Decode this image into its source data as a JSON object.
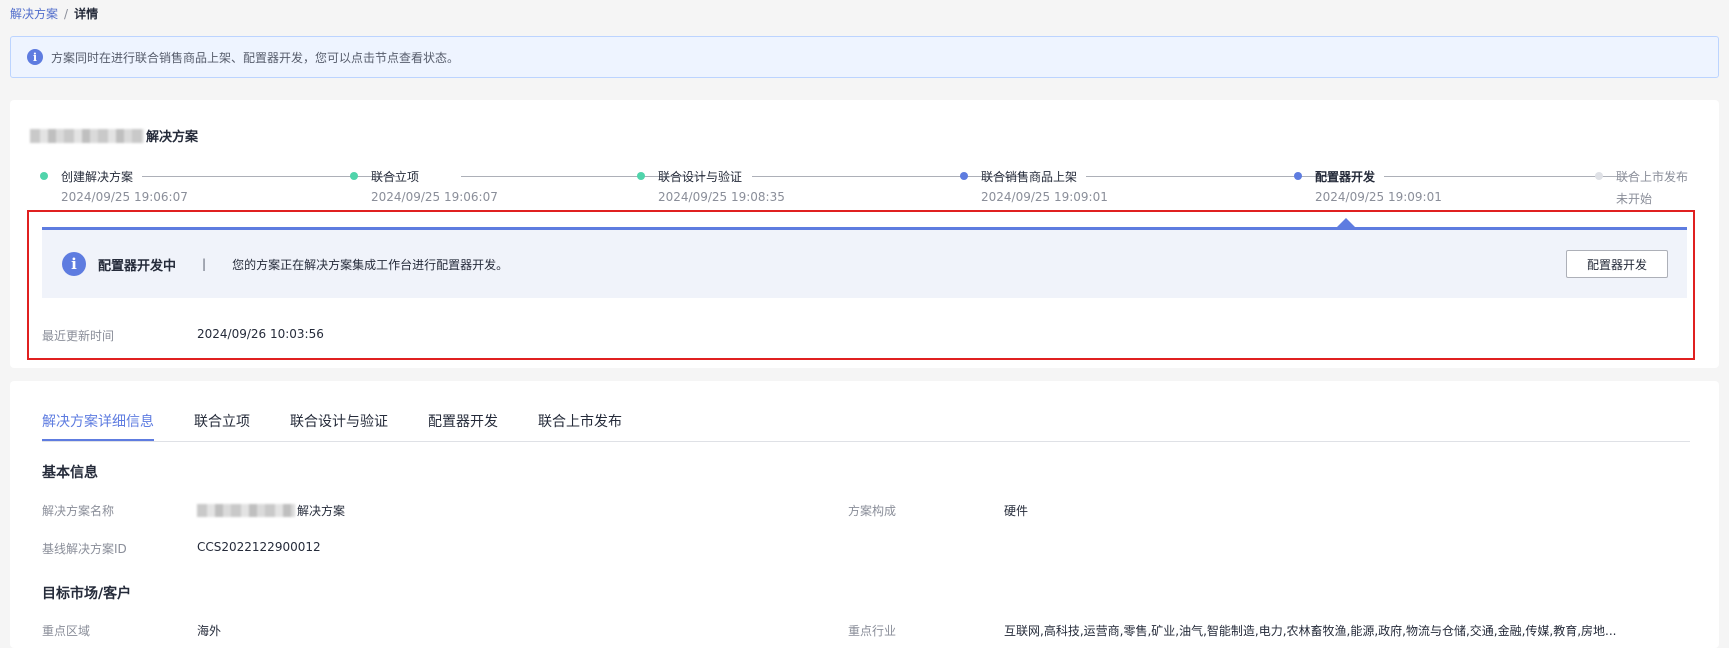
{
  "breadcrumb": {
    "parent": "解决方案",
    "separator": "/",
    "current": "详情"
  },
  "banner": {
    "icon": "info-icon",
    "text": "方案同时在进行联合销售商品上架、配置器开发，您可以点击节点查看状态。"
  },
  "solution": {
    "title_suffix": "解决方案"
  },
  "steps": [
    {
      "label": "创建解决方案",
      "time": "2024/09/25 19:06:07",
      "color": "#50d4ab"
    },
    {
      "label": "联合立项",
      "time": "2024/09/25 19:06:07",
      "color": "#50d4ab"
    },
    {
      "label": "联合设计与验证",
      "time": "2024/09/25 19:08:35",
      "color": "#50d4ab"
    },
    {
      "label": "联合销售商品上架",
      "time": "2024/09/25 19:09:01",
      "color": "#5e7ce0"
    },
    {
      "label": "配置器开发",
      "time": "2024/09/25 19:09:01",
      "color": "#5e7ce0"
    },
    {
      "label": "联合上市发布",
      "time": "未开始",
      "color": "#dfe1e6"
    }
  ],
  "status": {
    "title": "配置器开发中",
    "separator": "|",
    "description": "您的方案正在解决方案集成工作台进行配置器开发。",
    "button_label": "配置器开发"
  },
  "update": {
    "label": "最近更新时间",
    "value": "2024/09/26 10:03:56"
  },
  "tabs": [
    {
      "label": "解决方案详细信息",
      "active": true
    },
    {
      "label": "联合立项",
      "active": false
    },
    {
      "label": "联合设计与验证",
      "active": false
    },
    {
      "label": "配置器开发",
      "active": false
    },
    {
      "label": "联合上市发布",
      "active": false
    }
  ],
  "basic_info": {
    "title": "基本信息",
    "name_label": "解决方案名称",
    "name_suffix": "解决方案",
    "composition_label": "方案构成",
    "composition_value": "硬件",
    "baseline_label": "基线解决方案ID",
    "baseline_value": "CCS2022122900012"
  },
  "target_market": {
    "title": "目标市场/客户",
    "region_label": "重点区域",
    "region_value": "海外",
    "industry_label": "重点行业",
    "industry_value": "互联网,高科技,运营商,零售,矿业,油气,智能制造,电力,农林畜牧渔,能源,政府,物流与仓储,交通,金融,传媒,教育,房地..."
  }
}
